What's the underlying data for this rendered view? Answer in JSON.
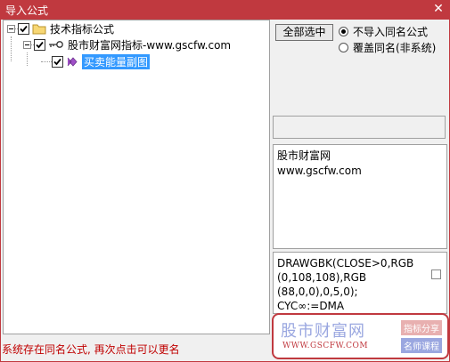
{
  "window": {
    "title": "导入公式",
    "close_glyph": "✕"
  },
  "tree": {
    "root": {
      "label": "技术指标公式",
      "checked": true
    },
    "child": {
      "label": "股市财富网指标-www.gscfw.com",
      "checked": true
    },
    "leaf": {
      "label": "买卖能量副图",
      "checked": true,
      "selected": true
    }
  },
  "controls": {
    "select_all_label": "全部选中",
    "radio_skip_label": "不导入同名公式",
    "radio_overwrite_label": "覆盖同名(非系统)",
    "selected_radio": "skip"
  },
  "info": {
    "line1": "股市财富网",
    "line2": "www.gscfw.com"
  },
  "code": {
    "lines": [
      "DRAWGBK(CLOSE>0,RGB",
      "(0,108,108),RGB",
      "(88,0,0),0,5,0);",
      "CYC∞:=DMA"
    ]
  },
  "status": {
    "text": "系统存在同名公式, 再次点击可以更名"
  },
  "watermark": {
    "name": "股市财富网",
    "url": "WWW.GSCFW.COM",
    "tag1": "指标分享",
    "tag2": "名师课程"
  },
  "colors": {
    "title_bar": "#c0393f",
    "selection": "#3399ff",
    "status_text": "#c00000"
  }
}
